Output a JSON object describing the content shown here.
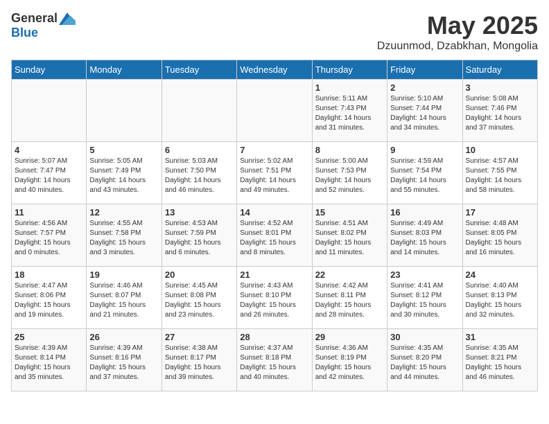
{
  "header": {
    "logo_general": "General",
    "logo_blue": "Blue",
    "title": "May 2025",
    "location": "Dzuunmod, Dzabkhan, Mongolia"
  },
  "days_of_week": [
    "Sunday",
    "Monday",
    "Tuesday",
    "Wednesday",
    "Thursday",
    "Friday",
    "Saturday"
  ],
  "weeks": [
    [
      {
        "day": "",
        "info": ""
      },
      {
        "day": "",
        "info": ""
      },
      {
        "day": "",
        "info": ""
      },
      {
        "day": "",
        "info": ""
      },
      {
        "day": "1",
        "info": "Sunrise: 5:11 AM\nSunset: 7:43 PM\nDaylight: 14 hours and 31 minutes."
      },
      {
        "day": "2",
        "info": "Sunrise: 5:10 AM\nSunset: 7:44 PM\nDaylight: 14 hours and 34 minutes."
      },
      {
        "day": "3",
        "info": "Sunrise: 5:08 AM\nSunset: 7:46 PM\nDaylight: 14 hours and 37 minutes."
      }
    ],
    [
      {
        "day": "4",
        "info": "Sunrise: 5:07 AM\nSunset: 7:47 PM\nDaylight: 14 hours and 40 minutes."
      },
      {
        "day": "5",
        "info": "Sunrise: 5:05 AM\nSunset: 7:49 PM\nDaylight: 14 hours and 43 minutes."
      },
      {
        "day": "6",
        "info": "Sunrise: 5:03 AM\nSunset: 7:50 PM\nDaylight: 14 hours and 46 minutes."
      },
      {
        "day": "7",
        "info": "Sunrise: 5:02 AM\nSunset: 7:51 PM\nDaylight: 14 hours and 49 minutes."
      },
      {
        "day": "8",
        "info": "Sunrise: 5:00 AM\nSunset: 7:53 PM\nDaylight: 14 hours and 52 minutes."
      },
      {
        "day": "9",
        "info": "Sunrise: 4:59 AM\nSunset: 7:54 PM\nDaylight: 14 hours and 55 minutes."
      },
      {
        "day": "10",
        "info": "Sunrise: 4:57 AM\nSunset: 7:55 PM\nDaylight: 14 hours and 58 minutes."
      }
    ],
    [
      {
        "day": "11",
        "info": "Sunrise: 4:56 AM\nSunset: 7:57 PM\nDaylight: 15 hours and 0 minutes."
      },
      {
        "day": "12",
        "info": "Sunrise: 4:55 AM\nSunset: 7:58 PM\nDaylight: 15 hours and 3 minutes."
      },
      {
        "day": "13",
        "info": "Sunrise: 4:53 AM\nSunset: 7:59 PM\nDaylight: 15 hours and 6 minutes."
      },
      {
        "day": "14",
        "info": "Sunrise: 4:52 AM\nSunset: 8:01 PM\nDaylight: 15 hours and 8 minutes."
      },
      {
        "day": "15",
        "info": "Sunrise: 4:51 AM\nSunset: 8:02 PM\nDaylight: 15 hours and 11 minutes."
      },
      {
        "day": "16",
        "info": "Sunrise: 4:49 AM\nSunset: 8:03 PM\nDaylight: 15 hours and 14 minutes."
      },
      {
        "day": "17",
        "info": "Sunrise: 4:48 AM\nSunset: 8:05 PM\nDaylight: 15 hours and 16 minutes."
      }
    ],
    [
      {
        "day": "18",
        "info": "Sunrise: 4:47 AM\nSunset: 8:06 PM\nDaylight: 15 hours and 19 minutes."
      },
      {
        "day": "19",
        "info": "Sunrise: 4:46 AM\nSunset: 8:07 PM\nDaylight: 15 hours and 21 minutes."
      },
      {
        "day": "20",
        "info": "Sunrise: 4:45 AM\nSunset: 8:08 PM\nDaylight: 15 hours and 23 minutes."
      },
      {
        "day": "21",
        "info": "Sunrise: 4:43 AM\nSunset: 8:10 PM\nDaylight: 15 hours and 26 minutes."
      },
      {
        "day": "22",
        "info": "Sunrise: 4:42 AM\nSunset: 8:11 PM\nDaylight: 15 hours and 28 minutes."
      },
      {
        "day": "23",
        "info": "Sunrise: 4:41 AM\nSunset: 8:12 PM\nDaylight: 15 hours and 30 minutes."
      },
      {
        "day": "24",
        "info": "Sunrise: 4:40 AM\nSunset: 8:13 PM\nDaylight: 15 hours and 32 minutes."
      }
    ],
    [
      {
        "day": "25",
        "info": "Sunrise: 4:39 AM\nSunset: 8:14 PM\nDaylight: 15 hours and 35 minutes."
      },
      {
        "day": "26",
        "info": "Sunrise: 4:39 AM\nSunset: 8:16 PM\nDaylight: 15 hours and 37 minutes."
      },
      {
        "day": "27",
        "info": "Sunrise: 4:38 AM\nSunset: 8:17 PM\nDaylight: 15 hours and 39 minutes."
      },
      {
        "day": "28",
        "info": "Sunrise: 4:37 AM\nSunset: 8:18 PM\nDaylight: 15 hours and 40 minutes."
      },
      {
        "day": "29",
        "info": "Sunrise: 4:36 AM\nSunset: 8:19 PM\nDaylight: 15 hours and 42 minutes."
      },
      {
        "day": "30",
        "info": "Sunrise: 4:35 AM\nSunset: 8:20 PM\nDaylight: 15 hours and 44 minutes."
      },
      {
        "day": "31",
        "info": "Sunrise: 4:35 AM\nSunset: 8:21 PM\nDaylight: 15 hours and 46 minutes."
      }
    ]
  ]
}
